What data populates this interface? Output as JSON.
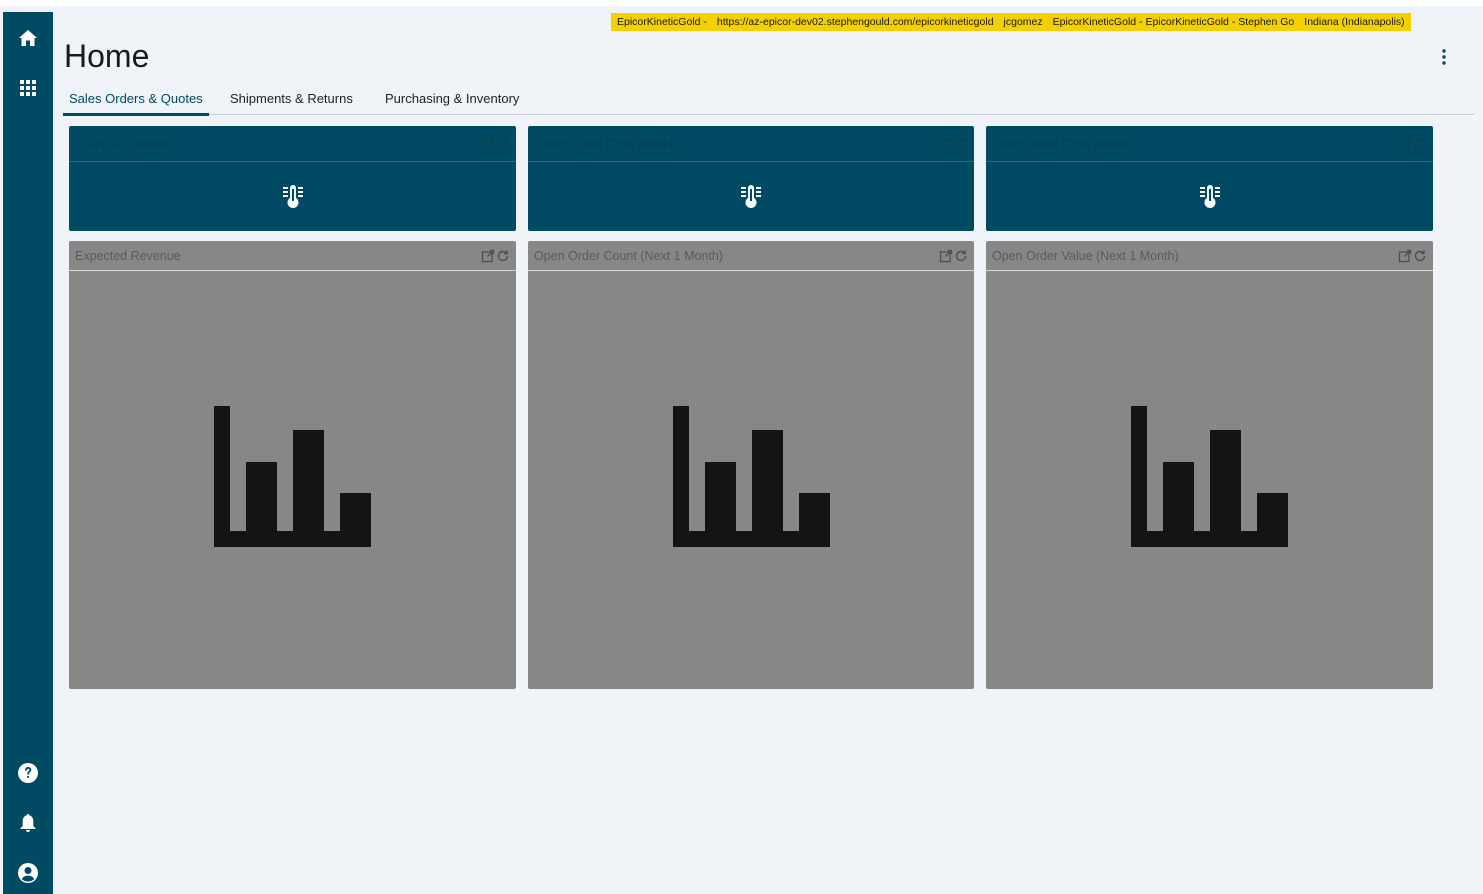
{
  "sidebar": {
    "top_items": [
      {
        "icon": "home-icon"
      },
      {
        "icon": "apps-grid-icon"
      }
    ],
    "bottom_items": [
      {
        "icon": "help-icon"
      },
      {
        "icon": "bell-icon"
      },
      {
        "icon": "account-icon"
      }
    ],
    "color": "#004b63"
  },
  "env_banner": {
    "app": "EpicorKineticGold -",
    "url": "https://az-epicor-dev02.stephengould.com/epicorkineticgold",
    "user": "jcgomez",
    "company": "EpicorKineticGold - EpicorKineticGold - Stephen Go",
    "site": "Indiana (Indianapolis)",
    "color": "#f5d000"
  },
  "header": {
    "title": "Home",
    "menu_icon": "more-vertical-icon"
  },
  "tabs": [
    {
      "label": "Sales Orders & Quotes",
      "active": true
    },
    {
      "label": "Shipments & Returns",
      "active": false
    },
    {
      "label": "Purchasing & Inventory",
      "active": false
    }
  ],
  "kpi_cards": [
    {
      "title": "Count Of Quotes",
      "icon": "thermometer-icon"
    },
    {
      "title": "Order Count (This Week)",
      "icon": "thermometer-icon"
    },
    {
      "title": "Order Value (This Week)",
      "icon": "thermometer-icon"
    }
  ],
  "chart_cards": [
    {
      "title": "Expected Revenue",
      "icon": "bar-chart-placeholder-icon"
    },
    {
      "title": "Open Order Count (Next 1 Month)",
      "icon": "bar-chart-placeholder-icon"
    },
    {
      "title": "Open Order Value (Next 1 Month)",
      "icon": "bar-chart-placeholder-icon"
    }
  ],
  "colors": {
    "primary": "#004b63",
    "chart_card_bg": "#878787",
    "page_bg": "#f0f3f7"
  }
}
